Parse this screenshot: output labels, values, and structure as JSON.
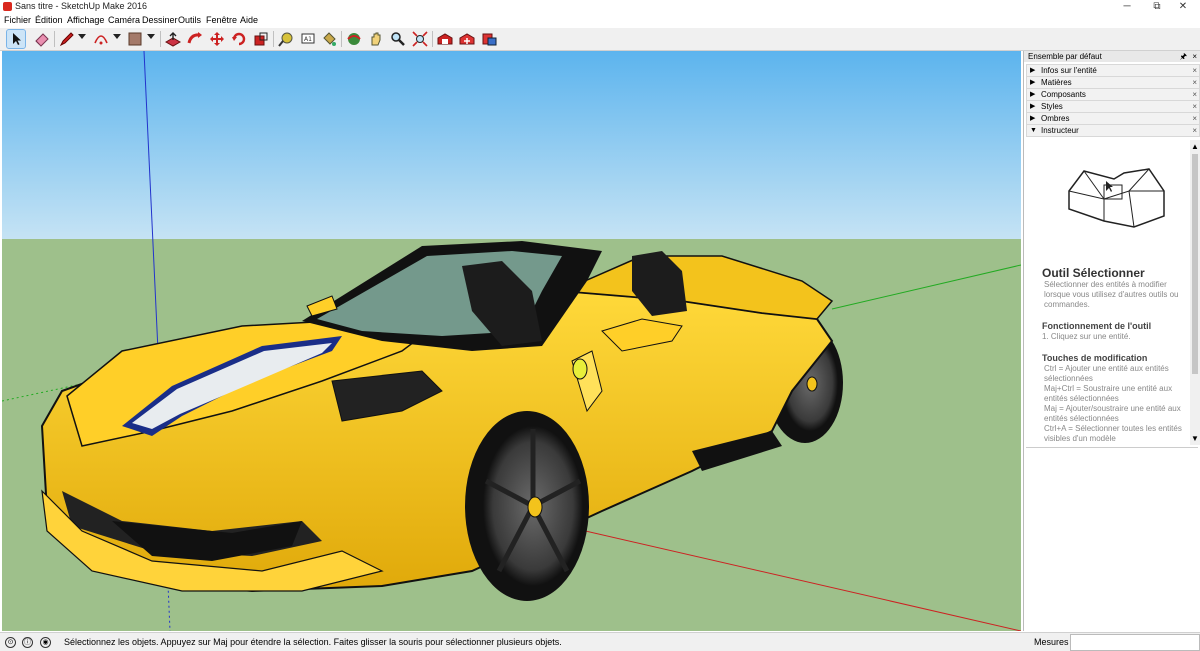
{
  "window": {
    "title": "Sans titre - SketchUp Make 2016",
    "minimize": "─",
    "maximize": "⧉",
    "close": "✕"
  },
  "menu": [
    "Fichier",
    "Édition",
    "Affichage",
    "Caméra",
    "Dessiner",
    "Outils",
    "Fenêtre",
    "Aide"
  ],
  "toolbar": {
    "tools": [
      "select-tool-icon",
      "eraser-tool-icon",
      "pencil-tool-icon",
      "arc-tool-icon",
      "rectangle-tool-icon",
      "push-pull-icon",
      "follow-me-icon",
      "move-tool-icon",
      "rotate-tool-icon",
      "scale-tool-icon",
      "tape-measure-icon",
      "text-tool-icon",
      "paint-bucket-icon",
      "orbit-icon",
      "pan-icon",
      "zoom-icon",
      "zoom-extents-icon",
      "warehouse-icon",
      "extension-warehouse-icon",
      "send-to-layout-icon"
    ],
    "selected": "select-tool-icon",
    "text_tool_label": "A1"
  },
  "tray": {
    "header": "Ensemble par défaut",
    "pin": "🖈",
    "sections": [
      {
        "label": "Infos sur l'entité",
        "expanded": false
      },
      {
        "label": "Matières",
        "expanded": false
      },
      {
        "label": "Composants",
        "expanded": false
      },
      {
        "label": "Styles",
        "expanded": false
      },
      {
        "label": "Ombres",
        "expanded": false
      },
      {
        "label": "Instructeur",
        "expanded": true
      }
    ],
    "close_glyph": "×",
    "collapsed_glyph": "▶",
    "expanded_glyph": "▼",
    "instructor": {
      "title": "Outil Sélectionner",
      "description": "Sélectionner des entités à modifier lorsque vous utilisez d'autres outils ou commandes.",
      "operation_heading": "Fonctionnement de l'outil",
      "operation_step": "1.   Cliquez sur une entité.",
      "modifier_heading": "Touches de modification",
      "modifiers": [
        "Ctrl = Ajouter une entité aux entités sélectionnées",
        "Maj+Ctrl = Soustraire une entité aux entités sélectionnées",
        "Maj = Ajouter/soustraire une entité aux entités sélectionnées",
        "Ctrl+A = Sélectionner toutes les entités visibles d'un modèle"
      ]
    }
  },
  "statusbar": {
    "text": "Sélectionnez les objets. Appuyez sur Maj pour étendre la sélection. Faites glisser la souris pour sélectionner plusieurs objets.",
    "geo_icon": "⊙",
    "info_icon": "ⓘ",
    "user_icon": "◉",
    "mesures_label": "Mesures",
    "mesures_value": ""
  },
  "colors": {
    "sky_top": "#5cb4ee",
    "sky_bottom": "#c5e3f4",
    "ground": "#9ec08b",
    "car_body": "#f3c31c",
    "car_shadow": "#c79a0c",
    "stripe_white": "#e8ecef",
    "stripe_blue": "#1a2e88",
    "axis_red": "#cc2222",
    "axis_green": "#22aa22",
    "axis_blue": "#2233cc"
  }
}
